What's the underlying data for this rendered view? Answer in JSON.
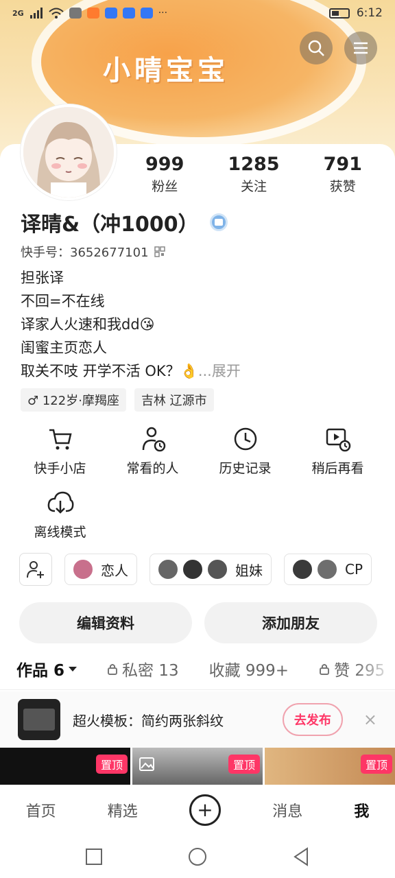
{
  "status": {
    "time": "6:12",
    "network": "2G"
  },
  "banner": {
    "title": "小晴宝宝"
  },
  "profile": {
    "name": "译晴&（冲1000）",
    "kuaishou_id": "快手号：3652677101",
    "stats": [
      {
        "value": "999",
        "label": "粉丝"
      },
      {
        "value": "1285",
        "label": "关注"
      },
      {
        "value": "791",
        "label": "获赞"
      }
    ],
    "bio": [
      "担张译",
      "不回=不在线",
      "译家人火速和我dd😘",
      "闺蜜主页恋人"
    ],
    "bio_last": "取关不吱 开学不活 OK？👌",
    "bio_more": "...展开",
    "tags": [
      "♂ 122岁·摩羯座",
      "吉林 辽源市"
    ]
  },
  "tools": [
    {
      "icon": "cart-icon",
      "label": "快手小店"
    },
    {
      "icon": "person-clock-icon",
      "label": "常看的人"
    },
    {
      "icon": "clock-icon",
      "label": "历史记录"
    },
    {
      "icon": "watch-later-icon",
      "label": "稍后再看"
    },
    {
      "icon": "download-cloud-icon",
      "label": "离线模式"
    }
  ],
  "groups": [
    {
      "label": "恋人"
    },
    {
      "label": "姐妹"
    },
    {
      "label": "CP"
    }
  ],
  "actions": {
    "edit": "编辑资料",
    "add_friend": "添加朋友"
  },
  "tabs": [
    {
      "label": "作品 6"
    },
    {
      "label": "私密 13"
    },
    {
      "label": "收藏 999+"
    },
    {
      "label": "赞 295"
    }
  ],
  "promo": {
    "text": "超火模板：简约两张斜纹",
    "button": "去发布",
    "close": "×"
  },
  "thumbs": {
    "pin_label": "置顶"
  },
  "bottom_nav": {
    "home": "首页",
    "featured": "精选",
    "plus": "+",
    "messages": "消息",
    "me": "我"
  },
  "colors": {
    "accent": "#fe3666",
    "banner": "#f6b565"
  }
}
